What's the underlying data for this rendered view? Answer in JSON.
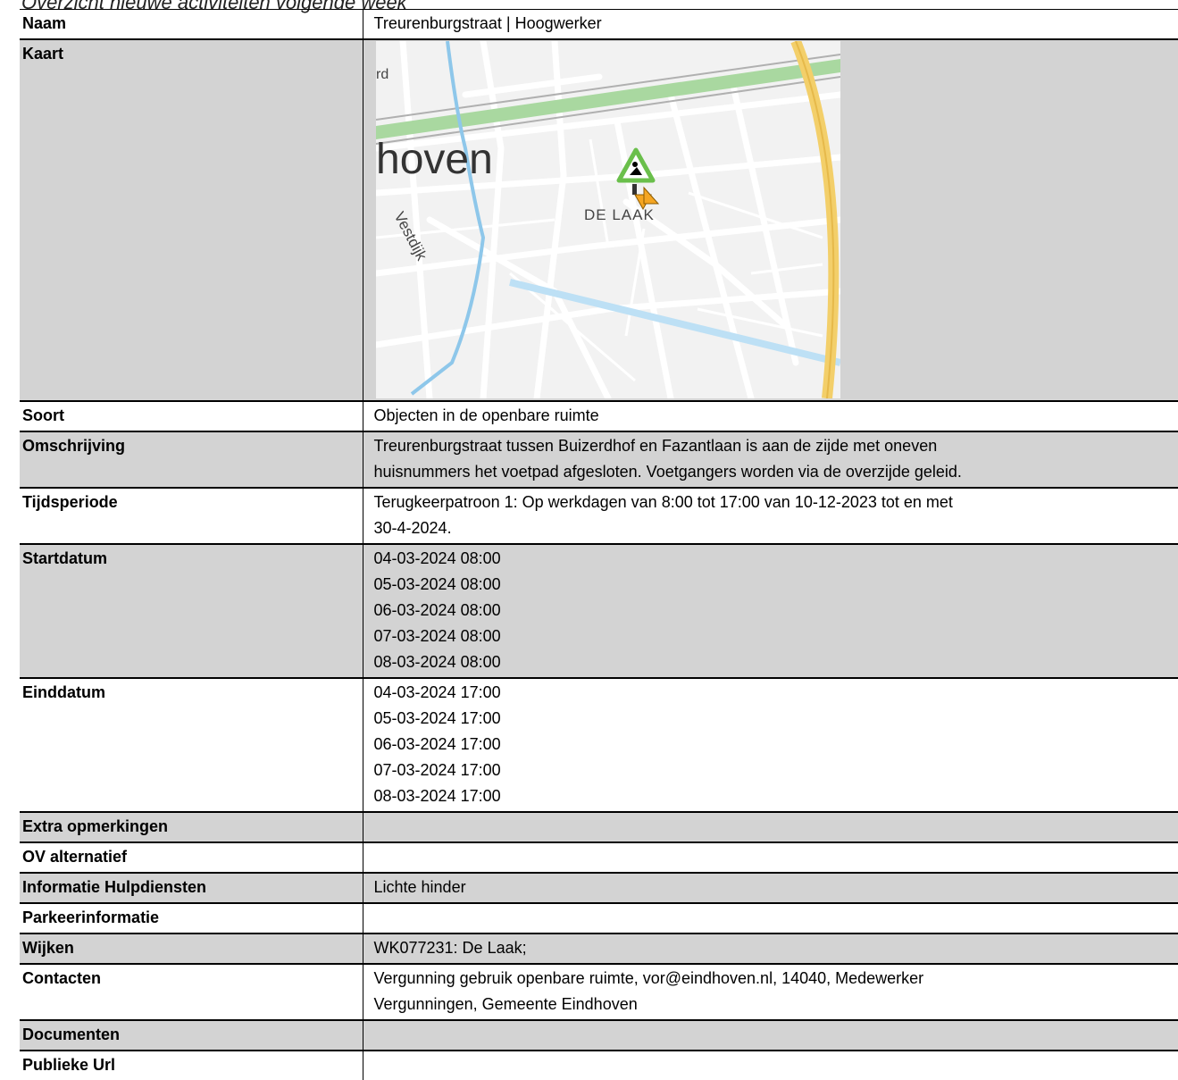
{
  "page": {
    "heading": "Overzicht nieuwe activiteiten volgende week"
  },
  "rows": {
    "naam": {
      "label": "Naam",
      "value": "Treurenburgstraat | Hoogwerker"
    },
    "kaart": {
      "label": "Kaart",
      "map_labels": {
        "district": "DE LAAK",
        "city_fragment": "hoven",
        "street": "Vestdijk",
        "road_fragment": "rd"
      },
      "map_markers": [
        "roadworks-icon",
        "traffic-warning-icon"
      ]
    },
    "soort": {
      "label": "Soort",
      "value": "Objecten in de openbare ruimte"
    },
    "omschrijving": {
      "label": "Omschrijving",
      "lines": [
        "Treurenburgstraat tussen Buizerdhof en Fazantlaan is aan de zijde met oneven",
        "huisnummers het voetpad afgesloten. Voetgangers worden via de overzijde geleid."
      ]
    },
    "tijdsperiode": {
      "label": "Tijdsperiode",
      "lines": [
        "Terugkeerpatroon 1: Op werkdagen van 8:00 tot 17:00 van 10-12-2023 tot en met",
        "30-4-2024."
      ]
    },
    "startdatum": {
      "label": "Startdatum",
      "lines": [
        "04-03-2024 08:00",
        "05-03-2024 08:00",
        "06-03-2024 08:00",
        "07-03-2024 08:00",
        "08-03-2024 08:00"
      ]
    },
    "einddatum": {
      "label": "Einddatum",
      "lines": [
        "04-03-2024 17:00",
        "05-03-2024 17:00",
        "06-03-2024 17:00",
        "07-03-2024 17:00",
        "08-03-2024 17:00"
      ]
    },
    "extra_opmerkingen": {
      "label": "Extra opmerkingen",
      "value": ""
    },
    "ov_alternatief": {
      "label": "OV alternatief",
      "value": ""
    },
    "informatie_hulpdiensten": {
      "label": "Informatie Hulpdiensten",
      "value": "Lichte hinder"
    },
    "parkeerinformatie": {
      "label": "Parkeerinformatie",
      "value": ""
    },
    "wijken": {
      "label": "Wijken",
      "value": "WK077231: De Laak;"
    },
    "contacten": {
      "label": "Contacten",
      "lines": [
        "Vergunning gebruik openbare ruimte, vor@eindhoven.nl, 14040, Medewerker",
        "Vergunningen, Gemeente Eindhoven"
      ]
    },
    "documenten": {
      "label": "Documenten",
      "value": ""
    },
    "publieke_url": {
      "label": "Publieke Url",
      "value": ""
    }
  },
  "colors": {
    "shaded_row": "#d3d3d3",
    "map_background": "#f2f2f2",
    "canal": "#8ec7ea",
    "railway_green": "#a9d8a0",
    "highway": "#f3cf6a",
    "roadworks_marker": "#6abf4b",
    "warning_marker": "#f5a623"
  }
}
